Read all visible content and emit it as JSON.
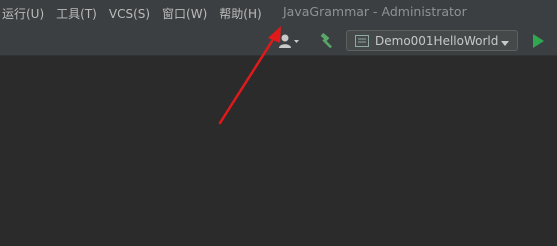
{
  "menubar": {
    "items": [
      "运行(U)",
      "工具(T)",
      "VCS(S)",
      "窗口(W)",
      "帮助(H)"
    ]
  },
  "window": {
    "title": "JavaGrammar - Administrator"
  },
  "toolbar": {
    "run_config_label": "Demo001HelloWorld",
    "icons": [
      "user-icon",
      "hammer-icon",
      "run-icon"
    ]
  },
  "colors": {
    "menubar_bg": "#3c3f41",
    "editor_bg": "#2b2b2b",
    "build_green": "#59a869",
    "run_green": "#2fa84f",
    "annotation_red": "#e01a1a"
  }
}
